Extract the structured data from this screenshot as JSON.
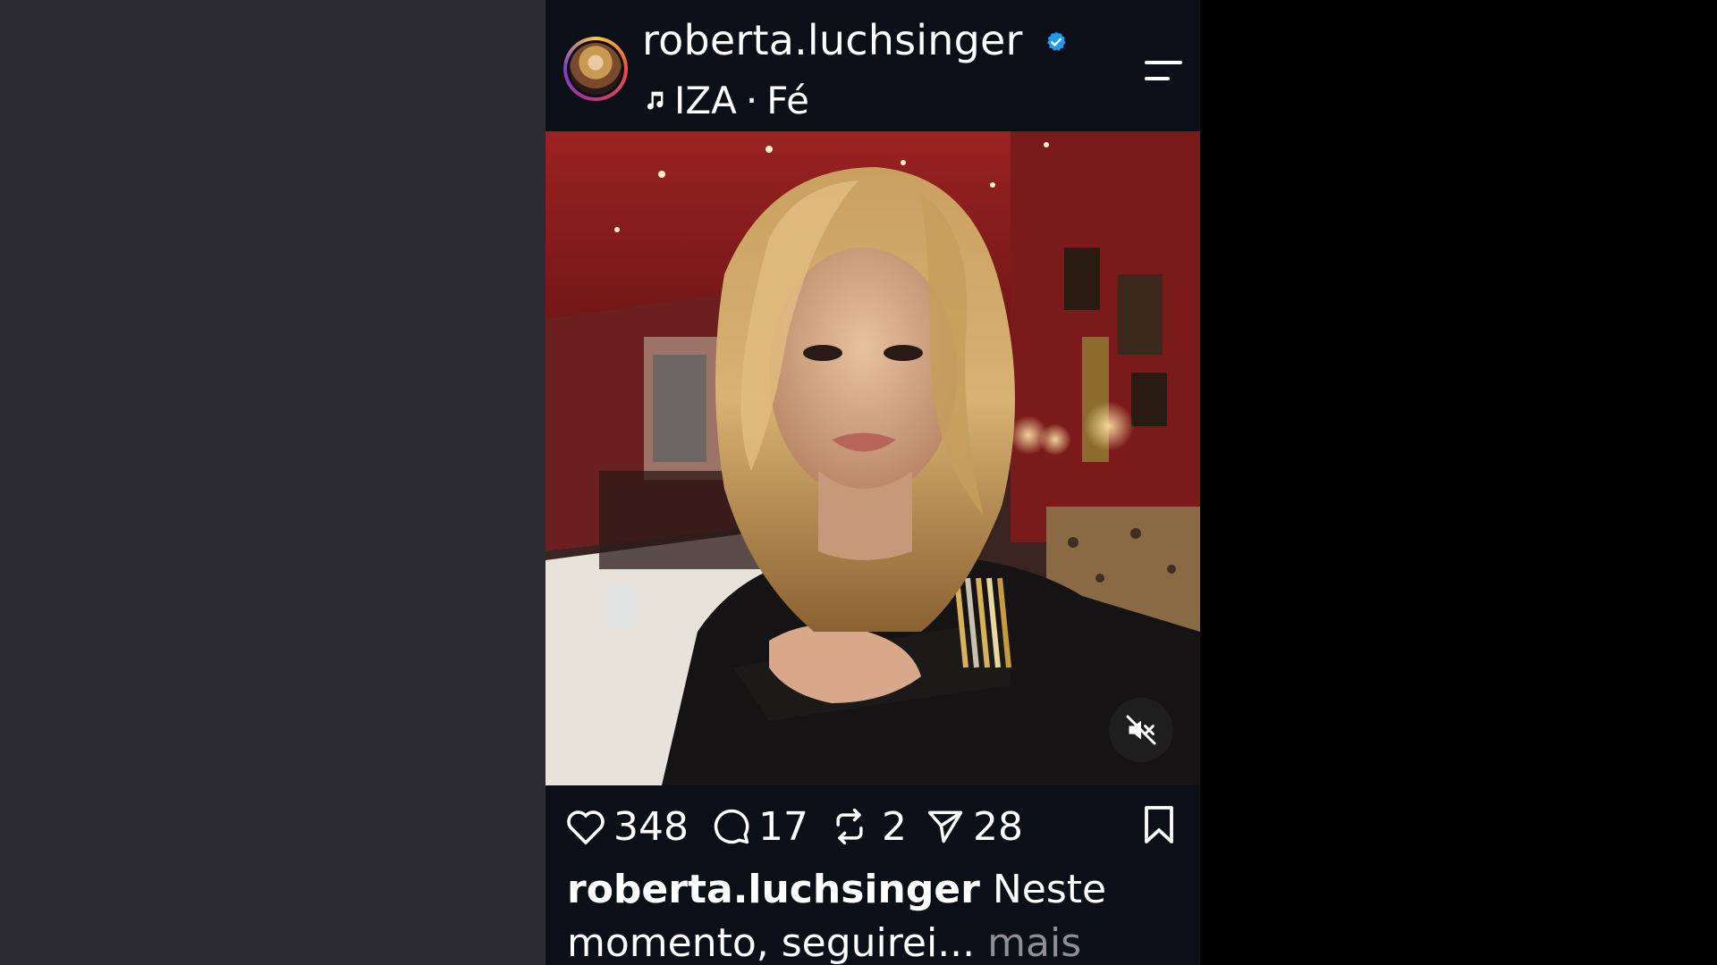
{
  "post": {
    "username": "roberta.luchsinger",
    "verified": true,
    "music": {
      "artist": "IZA",
      "separator": "·",
      "track": "Fé"
    },
    "audio_muted": true,
    "actions": {
      "likes": "348",
      "comments": "17",
      "reposts": "2",
      "shares": "28"
    },
    "caption": {
      "username": "roberta.luchsinger",
      "text_line1": "Neste",
      "text_line2": "momento, seguirei...",
      "more": "mais"
    }
  },
  "icons": {
    "verified": "verified-badge-icon",
    "music": "music-note-icon",
    "menu": "menu-icon",
    "mute": "speaker-muted-icon",
    "like": "heart-icon",
    "comment": "comment-bubble-icon",
    "repost": "repost-icon",
    "share": "send-icon",
    "save": "bookmark-icon"
  },
  "colors": {
    "background_left": "#2b2b30",
    "background_right": "#000000",
    "app_background": "#0b0f17",
    "verified_blue": "#1d9bf0",
    "muted_text": "#8e8e94"
  }
}
